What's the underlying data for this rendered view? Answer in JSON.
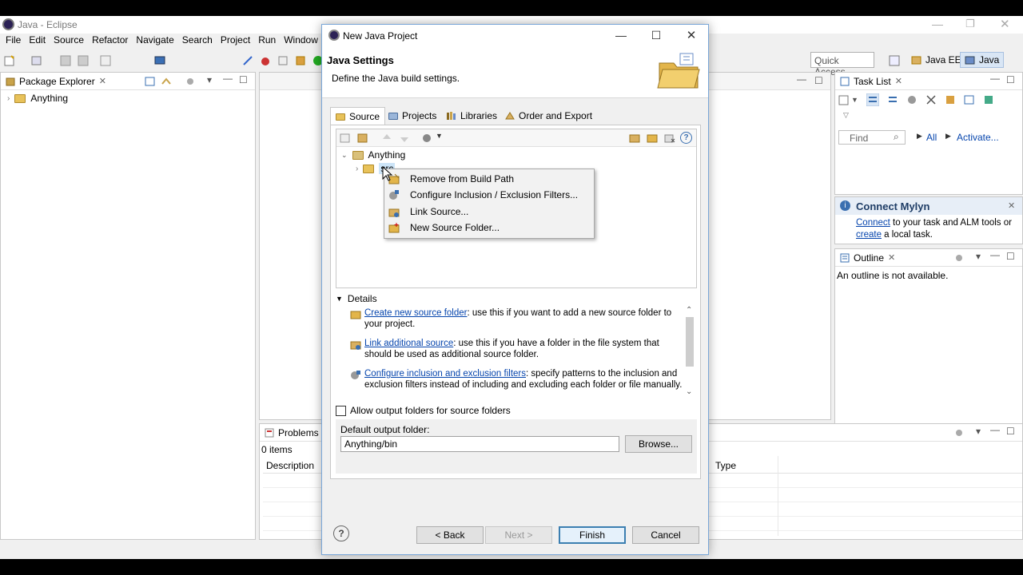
{
  "eclipse": {
    "title": "Java - Eclipse",
    "menu": [
      "File",
      "Edit",
      "Source",
      "Refactor",
      "Navigate",
      "Search",
      "Project",
      "Run",
      "Window"
    ],
    "quick_access": "Quick Access",
    "perspectives": {
      "java_ee": "Java EE",
      "java": "Java"
    }
  },
  "package_explorer": {
    "title": "Package Explorer",
    "project": "Anything"
  },
  "task_list": {
    "title": "Task List",
    "find_placeholder": "Find",
    "all": "All",
    "activate": "Activate..."
  },
  "mylyn": {
    "title": "Connect Mylyn",
    "connect": "Connect",
    "text1": " to your task and ALM tools or",
    "create": "create",
    "text2": " a local task."
  },
  "outline": {
    "title": "Outline",
    "message": "An outline is not available."
  },
  "problems": {
    "title": "Problems",
    "count": "0 items",
    "col_description": "Description",
    "col_type": "Type"
  },
  "dialog": {
    "title": "New Java Project",
    "heading": "Java Settings",
    "subheading": "Define the Java build settings.",
    "tabs": [
      "Source",
      "Projects",
      "Libraries",
      "Order and Export"
    ],
    "tree": {
      "project": "Anything",
      "src": "src"
    },
    "context_menu": [
      "Remove from Build Path",
      "Configure Inclusion / Exclusion Filters...",
      "Link Source...",
      "New Source Folder..."
    ],
    "details_label": "Details",
    "details": [
      {
        "link": "Create new source folder",
        "text": ": use this if you want to add a new source folder to your project."
      },
      {
        "link": "Link additional source",
        "text": ": use this if you have a folder in the file system that should be used as additional source folder."
      },
      {
        "link": "Configure inclusion and exclusion filters",
        "text": ": specify patterns to the inclusion and exclusion filters instead of including and excluding each folder or file manually."
      }
    ],
    "allow_output": "Allow output folders for source folders",
    "default_output_label": "Default output folder:",
    "default_output_value": "Anything/bin",
    "browse": "Browse...",
    "back": "< Back",
    "next": "Next >",
    "finish": "Finish",
    "cancel": "Cancel"
  }
}
